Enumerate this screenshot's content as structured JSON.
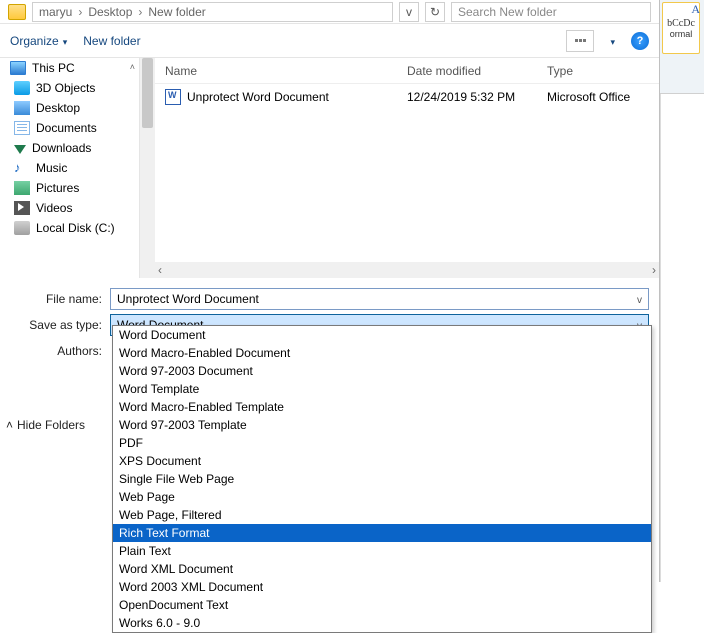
{
  "addr": {
    "crumb1": "maryu",
    "crumb2": "Desktop",
    "crumb3": "New folder",
    "searchPlaceholder": "Search New folder"
  },
  "toolbar": {
    "organize": "Organize",
    "newFolder": "New folder"
  },
  "sidebar": {
    "thisPC": "This PC",
    "items": [
      "3D Objects",
      "Desktop",
      "Documents",
      "Downloads",
      "Music",
      "Pictures",
      "Videos",
      "Local Disk (C:)"
    ]
  },
  "columns": {
    "name": "Name",
    "date": "Date modified",
    "type": "Type"
  },
  "files": [
    {
      "name": "Unprotect Word Document",
      "date": "12/24/2019 5:32 PM",
      "type": "Microsoft Office"
    }
  ],
  "form": {
    "fileNameLabel": "File name:",
    "fileNameValue": "Unprotect Word Document",
    "saveTypeLabel": "Save as type:",
    "saveTypeValue": "Word Document",
    "authorsLabel": "Authors:"
  },
  "hideFolders": "Hide Folders",
  "typeOptions": [
    "Word Document",
    "Word Macro-Enabled Document",
    "Word 97-2003 Document",
    "Word Template",
    "Word Macro-Enabled Template",
    "Word 97-2003 Template",
    "PDF",
    "XPS Document",
    "Single File Web Page",
    "Web Page",
    "Web Page, Filtered",
    "Rich Text Format",
    "Plain Text",
    "Word XML Document",
    "Word 2003 XML Document",
    "OpenDocument Text",
    "Works 6.0 - 9.0"
  ],
  "typeSelectedIndex": 11,
  "ribbon": {
    "styleSample": "bCcDc",
    "styleName": "ormal",
    "a": "A"
  }
}
